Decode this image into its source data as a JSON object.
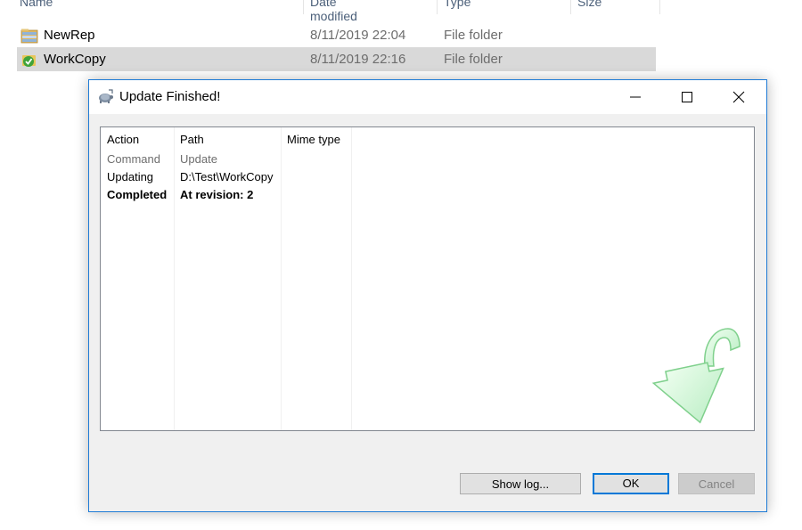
{
  "explorer": {
    "columns": [
      "Name",
      "Date modified",
      "Type",
      "Size"
    ],
    "rows": [
      {
        "name": "NewRep",
        "date": "8/11/2019 22:04",
        "type": "File folder",
        "icon": "repository-folder-icon"
      },
      {
        "name": "WorkCopy",
        "date": "8/11/2019 22:16",
        "type": "File folder",
        "icon": "working-copy-folder-icon"
      }
    ]
  },
  "dialog": {
    "title": "Update Finished!",
    "title_icon": "tortoise-svn-icon",
    "list": {
      "columns": [
        "Action",
        "Path",
        "Mime type"
      ],
      "rows": [
        {
          "action": "Command",
          "path": "Update",
          "mime": "",
          "style": "gray"
        },
        {
          "action": "Updating",
          "path": "D:\\Test\\WorkCopy",
          "mime": "",
          "style": "normal"
        },
        {
          "action": "Completed",
          "path": "At revision: 2",
          "mime": "",
          "style": "bold"
        }
      ]
    },
    "watermark_icon": "green-update-arrow-icon",
    "buttons": {
      "show_log": "Show log...",
      "ok": "OK",
      "cancel": "Cancel"
    }
  },
  "colors": {
    "accent": "#0078d7",
    "selection": "#d9d9d9",
    "dialog_bg": "#f0f0f0"
  }
}
